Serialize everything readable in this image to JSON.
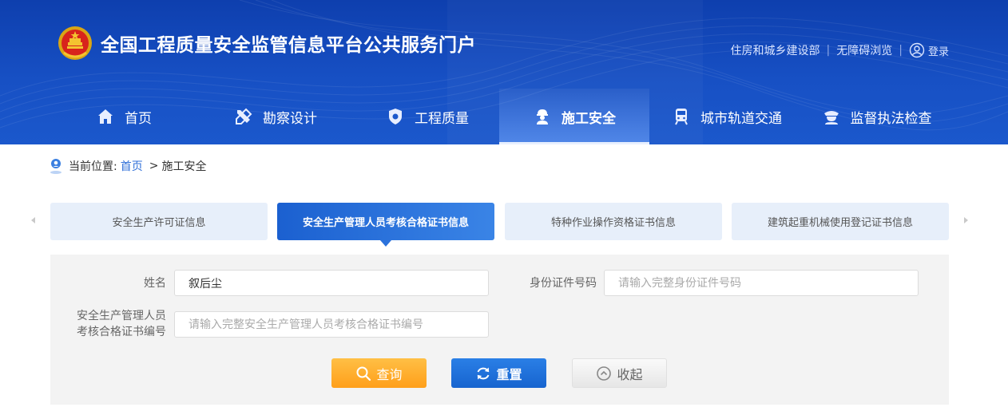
{
  "header": {
    "site_title": "全国工程质量安全监管信息平台公共服务门户",
    "links": [
      "住房和城乡建设部",
      "无障碍浏览"
    ],
    "login_label": "登录"
  },
  "nav": {
    "items": [
      {
        "label": "首页",
        "icon": "home-icon"
      },
      {
        "label": "勘察设计",
        "icon": "tools-icon"
      },
      {
        "label": "工程质量",
        "icon": "shield-icon"
      },
      {
        "label": "施工安全",
        "icon": "worker-icon",
        "active": true
      },
      {
        "label": "城市轨道交通",
        "icon": "train-icon"
      },
      {
        "label": "监督执法检查",
        "icon": "officer-icon"
      }
    ]
  },
  "breadcrumb": {
    "prefix": "当前位置:",
    "home": "首页",
    "separator": ">",
    "current": "施工安全"
  },
  "tabs": [
    {
      "label": "安全生产许可证信息"
    },
    {
      "label": "安全生产管理人员考核合格证书信息",
      "active": true
    },
    {
      "label": "特种作业操作资格证书信息"
    },
    {
      "label": "建筑起重机械使用登记证书信息"
    }
  ],
  "form": {
    "name_label": "姓名",
    "name_value": "叙后尘",
    "id_label": "身份证件号码",
    "id_placeholder": "请输入完整身份证件号码",
    "cert_label_line1": "安全生产管理人员",
    "cert_label_line2": "考核合格证书编号",
    "cert_placeholder": "请输入完整安全生产管理人员考核合格证书编号",
    "query_label": "查询",
    "reset_label": "重置",
    "collapse_label": "收起"
  },
  "colors": {
    "header_blue": "#1750c4",
    "tab_active": "#1b60d0",
    "query_orange": "#ff9f1a",
    "reset_blue": "#1764cf"
  }
}
